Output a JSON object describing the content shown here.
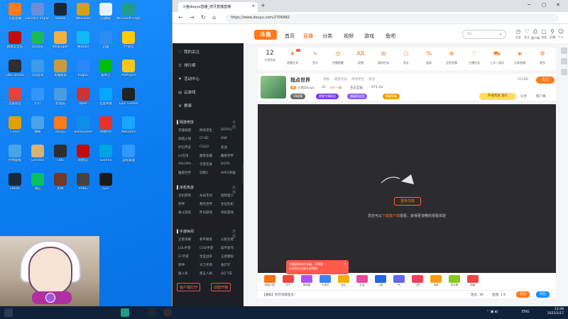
{
  "desktop": {
    "icons": [
      {
        "label": "斗鱼直播",
        "color": "#ff7a1a"
      },
      {
        "label": "Genshin Impact",
        "color": "#6b8fd6"
      },
      {
        "label": "Steam",
        "color": "#1b2838"
      },
      {
        "label": "WeGame",
        "color": "#d4a017"
      },
      {
        "label": "回收站",
        "color": "#e9f1fb"
      },
      {
        "label": "Microsoft Edge",
        "color": "#1f9c8a"
      },
      {
        "label": "网易云音乐",
        "color": "#c20c0c"
      },
      {
        "label": "QQ音乐",
        "color": "#1db954"
      },
      {
        "label": "Wallpaper",
        "color": "#f2b13c"
      },
      {
        "label": "腾讯QQ",
        "color": "#12b7f5"
      },
      {
        "label": "迅雷",
        "color": "#2d8cf0"
      },
      {
        "label": "YY语音",
        "color": "#ffcc00"
      },
      {
        "label": "OBS Studio",
        "color": "#302e31"
      },
      {
        "label": "QQ游戏",
        "color": "#3c9ae8"
      },
      {
        "label": "英雄联盟",
        "color": "#c89b3c"
      },
      {
        "label": "Kugou",
        "color": "#2a85ff"
      },
      {
        "label": "爱奇艺",
        "color": "#00be06"
      },
      {
        "label": "PotPlayer",
        "color": "#f5c518"
      },
      {
        "label": "迅雷影音",
        "color": "#e6423c"
      },
      {
        "label": "钉钉",
        "color": "#3296fa"
      },
      {
        "label": "此电脑",
        "color": "#4a9be0"
      },
      {
        "label": "Apex",
        "color": "#cc3333"
      },
      {
        "label": "百度网盘",
        "color": "#06a7ff"
      },
      {
        "label": "Epic Games",
        "color": "#222"
      },
      {
        "label": "CSGO",
        "color": "#e0a100"
      },
      {
        "label": "网络",
        "color": "#4aa3e8"
      },
      {
        "label": "douyu",
        "color": "#ff7a1a"
      },
      {
        "label": "Teamviewer",
        "color": "#0e8ee9"
      },
      {
        "label": "网易UU",
        "color": "#e5332a"
      },
      {
        "label": "WeGame",
        "color": "#1aa6ff"
      },
      {
        "label": "控制面板",
        "color": "#4aa3e8"
      },
      {
        "label": "Genshin",
        "color": "#d9b26e"
      },
      {
        "label": "OBS",
        "color": "#302e31"
      },
      {
        "label": "网易云",
        "color": "#c20c0c"
      },
      {
        "label": "Garena",
        "color": "#00a4e4"
      },
      {
        "label": "远程桌面",
        "color": "#3399ff"
      },
      {
        "label": "Steam",
        "color": "#1b2838"
      },
      {
        "label": "微信",
        "color": "#07c160"
      },
      {
        "label": "剪映",
        "color": "#6f3a2a"
      },
      {
        "label": "PUBG",
        "color": "#444"
      },
      {
        "label": "Epic",
        "color": "#1a1a1a"
      }
    ]
  },
  "taskbar": {
    "time": "11:49",
    "date": "2021/1/17",
    "lang": "ENG"
  },
  "browser": {
    "tab_title": "斗鱼douyu直播_虎牙直播直播",
    "url": "https://www.douyu.com/2706482"
  },
  "site": {
    "logo": "斗鱼",
    "nav": [
      "首页",
      "直播",
      "分类",
      "视频",
      "游戏",
      "鱼吧"
    ],
    "search_placeholder": "lks",
    "header_icons": [
      {
        "glyph": "◷",
        "label": "历史"
      },
      {
        "glyph": "♡",
        "label": "关注"
      },
      {
        "glyph": "⎙",
        "label": "客户端"
      },
      {
        "glyph": "▢",
        "label": "消息"
      },
      {
        "glyph": "⚲",
        "label": "开播"
      },
      {
        "glyph": "☺",
        "label": "个人"
      }
    ]
  },
  "sidebar": {
    "items": [
      {
        "icon": "♡",
        "label": "我的关注"
      },
      {
        "icon": "☰",
        "label": "排行榜"
      },
      {
        "icon": "⚑",
        "label": "活动中心"
      },
      {
        "icon": "▤",
        "label": "云游戏"
      },
      {
        "icon": "♛",
        "label": "赛事"
      }
    ],
    "groups": [
      {
        "title": "网游竞技",
        "more": "全部",
        "cats": [
          "英雄联盟",
          "绝地求生",
          "DOTA2",
          "穿越火线",
          "CFHD",
          "DNF",
          "炉石传说",
          "CSGO",
          "逆战",
          "lol云顶",
          "魔兽争霸",
          "魔兽世界",
          "VALORA...",
          "守望先锋",
          "DOTA",
          "魔兽世界",
          "剑网3",
          "APEX英雄"
        ]
      },
      {
        "title": "单机热游",
        "more": "全部",
        "cats": [
          "主机游戏",
          "永劫无间",
          "怪物猎人",
          "原神",
          "我的世界",
          "生化危机",
          "格斗游戏",
          "怀旧游戏",
          "单机游戏"
        ]
      },
      {
        "title": "手游休闲",
        "more": "全部",
        "cats": [
          "王者荣耀",
          "和平精英",
          "火影忍者",
          "LOL手游",
          "COD手游",
          "崩坏星穹",
          "CF手游",
          "皇室战争",
          "王者模拟",
          "原神",
          "天刀手游",
          "金铲铲",
          "狼人杀",
          "第五人格",
          "QQ飞车"
        ]
      }
    ],
    "buttons": [
      "客户端打开",
      "创建开播"
    ]
  },
  "room": {
    "level_num": "12",
    "level_label": "主播等级",
    "shortcuts": [
      {
        "glyph": "★",
        "label": "直播开关",
        "badge": "1"
      },
      {
        "glyph": "∿",
        "label": "音乐"
      },
      {
        "glyph": "◷",
        "label": "开播提醒"
      },
      {
        "glyph": "AB",
        "label": "竞猜"
      },
      {
        "glyph": "⊞",
        "label": "福利任务"
      },
      {
        "glyph": "⬡",
        "label": "鱼丸"
      },
      {
        "glyph": "%",
        "label": "道具"
      },
      {
        "glyph": "⊕",
        "label": "全民竞猜"
      },
      {
        "glyph": "♡",
        "label": "主播任务"
      },
      {
        "glyph": "⛟",
        "label": "上车一起玩"
      },
      {
        "glyph": "◈",
        "label": "分享直播"
      },
      {
        "glyph": "⚙",
        "label": "更多"
      }
    ],
    "title": "指点世界",
    "tags": [
      "举报",
      "网游竞技",
      "绝地求生",
      "原创"
    ],
    "line": [
      "斗鱼Douyu",
      "32",
      "V3·一般",
      "生态互娱",
      "974.2w"
    ],
    "badges": [
      {
        "text": "V8勋章",
        "color": "#6c6c6c"
      },
      {
        "text": "超管专属粉丝",
        "color": "#7c3aed"
      },
      {
        "text": "超级粉丝团",
        "color": "#8b5cf6"
      },
      {
        "text": "荣耀等级",
        "color": "#f59e0b"
      }
    ],
    "follow_label": "关注",
    "follow_count": "2018B",
    "gift_btn": "开通贵族 送礼",
    "actions": [
      "分享",
      "客户端"
    ]
  },
  "player": {
    "retry": "重新加载",
    "msg_prefix": "您还可以",
    "msg_link": "下载客户端",
    "msg_suffix": "观看，获得更流畅的观看体验"
  },
  "gifts": {
    "items": [
      {
        "label": "超级火箭",
        "color": "#f97316"
      },
      {
        "label": "办卡",
        "color": "#ef4444"
      },
      {
        "label": "棒棒糖",
        "color": "#a855f7"
      },
      {
        "label": "大宝剑",
        "color": "#3b82f6"
      },
      {
        "label": "鱼丸",
        "color": "#eab308"
      },
      {
        "label": "礼盒",
        "color": "#ec4899"
      },
      {
        "label": "火箭",
        "color": "#2563eb"
      },
      {
        "label": "PK",
        "color": "#6366f1"
      },
      {
        "label": "飞机",
        "color": "#f43f5e"
      },
      {
        "label": "宝箱",
        "color": "#f59e0b"
      },
      {
        "label": "荧光棒",
        "color": "#84cc16"
      },
      {
        "label": "超跑",
        "color": "#ef4444"
      }
    ],
    "promo_line1": "主播送给你的宝箱，可领取",
    "promo_line2": "开启鱼丸宝箱立即领取"
  },
  "statusbar": {
    "text": "【通知】你可领取鱼丸！",
    "right": [
      "鱼丸: 36",
      "鱼翅: 1.6"
    ],
    "buttons": [
      {
        "text": "充值",
        "color": "#ff7a1a"
      },
      {
        "text": "背包",
        "color": "#1890ff"
      }
    ]
  }
}
